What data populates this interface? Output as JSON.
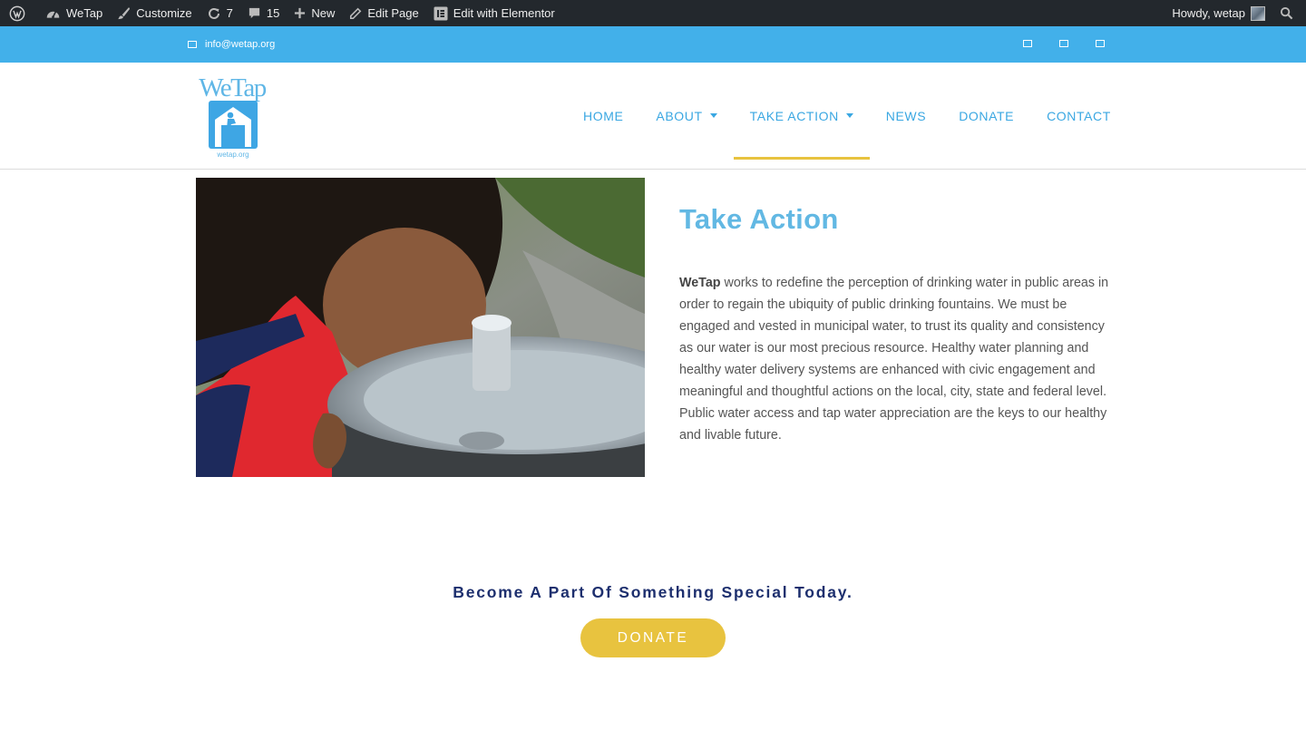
{
  "admin_bar": {
    "site_name": "WeTap",
    "customize": "Customize",
    "updates_count": "7",
    "comments_count": "15",
    "new_label": "New",
    "edit_page": "Edit Page",
    "edit_elementor": "Edit with Elementor",
    "howdy": "Howdy, wetap"
  },
  "topbar": {
    "email": "info@wetap.org",
    "social_icons": [
      "social-icon-1",
      "social-icon-2",
      "social-icon-3"
    ]
  },
  "header": {
    "logo_wordmark": "WeTap",
    "logo_url_text": "wetap.org",
    "nav": [
      {
        "label": "HOME"
      },
      {
        "label": "ABOUT"
      },
      {
        "label": "TAKE ACTION"
      },
      {
        "label": "NEWS"
      },
      {
        "label": "DONATE"
      },
      {
        "label": "CONTACT"
      }
    ]
  },
  "main": {
    "title": "Take Action",
    "intro_bold": "WeTap",
    "intro_text": " works to redefine the perception of drinking water in public areas in order to regain the ubiquity of public drinking fountains.  We must be engaged and vested in municipal water, to trust its quality and consistency as our water is our most precious resource.  Healthy water planning and healthy water delivery systems are enhanced with civic engagement and meaningful and thoughtful actions on the local, city, state and federal level.  Public water access and tap water appreciation are the keys to our healthy and livable future."
  },
  "cta": {
    "title": "Become A Part Of Something Special Today.",
    "button": "DONATE"
  },
  "colors": {
    "admin_bar": "#23282d",
    "topbar": "#42b0ea",
    "nav_text": "#3aa7e2",
    "active_underline": "#e8c33f",
    "title": "#62b8e3",
    "cta_title": "#1d2f6e",
    "donate_button": "#e8c33f"
  }
}
